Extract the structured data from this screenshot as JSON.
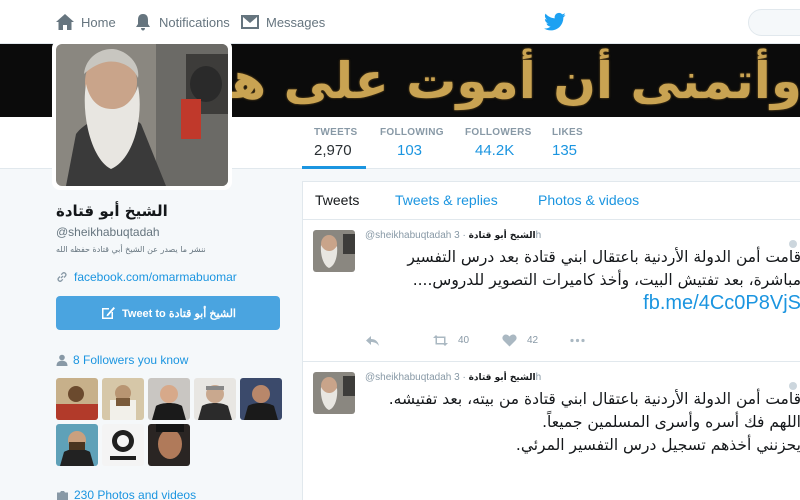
{
  "nav": {
    "home": "Home",
    "notifications": "Notifications",
    "messages": "Messages"
  },
  "banner": {
    "text": "وأتمنى أن أموت على هـ"
  },
  "stats": [
    {
      "label": "TWEETS",
      "value": "2,970"
    },
    {
      "label": "FOLLOWING",
      "value": "103"
    },
    {
      "label": "FOLLOWERS",
      "value": "44.2K"
    },
    {
      "label": "LIKES",
      "value": "135"
    }
  ],
  "profile": {
    "name": "الشيخ أبو قتادة",
    "handle": "@sheikhabuqtadah",
    "bio": "ننشر ما يصدر عن الشيخ أبي قتادة حفظه الله",
    "link": "facebook.com/omarmabuomar",
    "tweet_to_label": "Tweet to الشيخ أبو قتادة",
    "followers_you_know": "8 Followers you know",
    "photos_videos": "230 Photos and videos"
  },
  "tabs": [
    "Tweets",
    "Tweets & replies",
    "Photos & videos"
  ],
  "tweets": [
    {
      "name": "الشيخ أبو قتادة",
      "handle": "@sheikhabuqtadah",
      "time": "· 3h",
      "text": "قامت أمن الدولة الأردنية باعتقال ابني قتادة بعد درس التفسير مباشرة، بعد تفتيش البيت، وأخذ كاميرات التصوير للدروس.... ",
      "link": "fb.me/4Cc0P8VjS",
      "retweets": "40",
      "likes": "42"
    },
    {
      "name": "الشيخ أبو قتادة",
      "handle": "@sheikhabuqtadah",
      "time": "· 3h",
      "lines": [
        "قامت أمن الدولة الأردنية باعتقال ابني قتادة من بيته، بعد تفتيشه.",
        "اللهم فك أسره وأسرى المسلمين جميعاً.",
        "يحزنني أخذهم تسجيل درس التفسير المرئي."
      ]
    }
  ],
  "colors": {
    "accent": "#1b95e0",
    "button": "#4aa4e0",
    "banner_text": "#c9a352"
  }
}
